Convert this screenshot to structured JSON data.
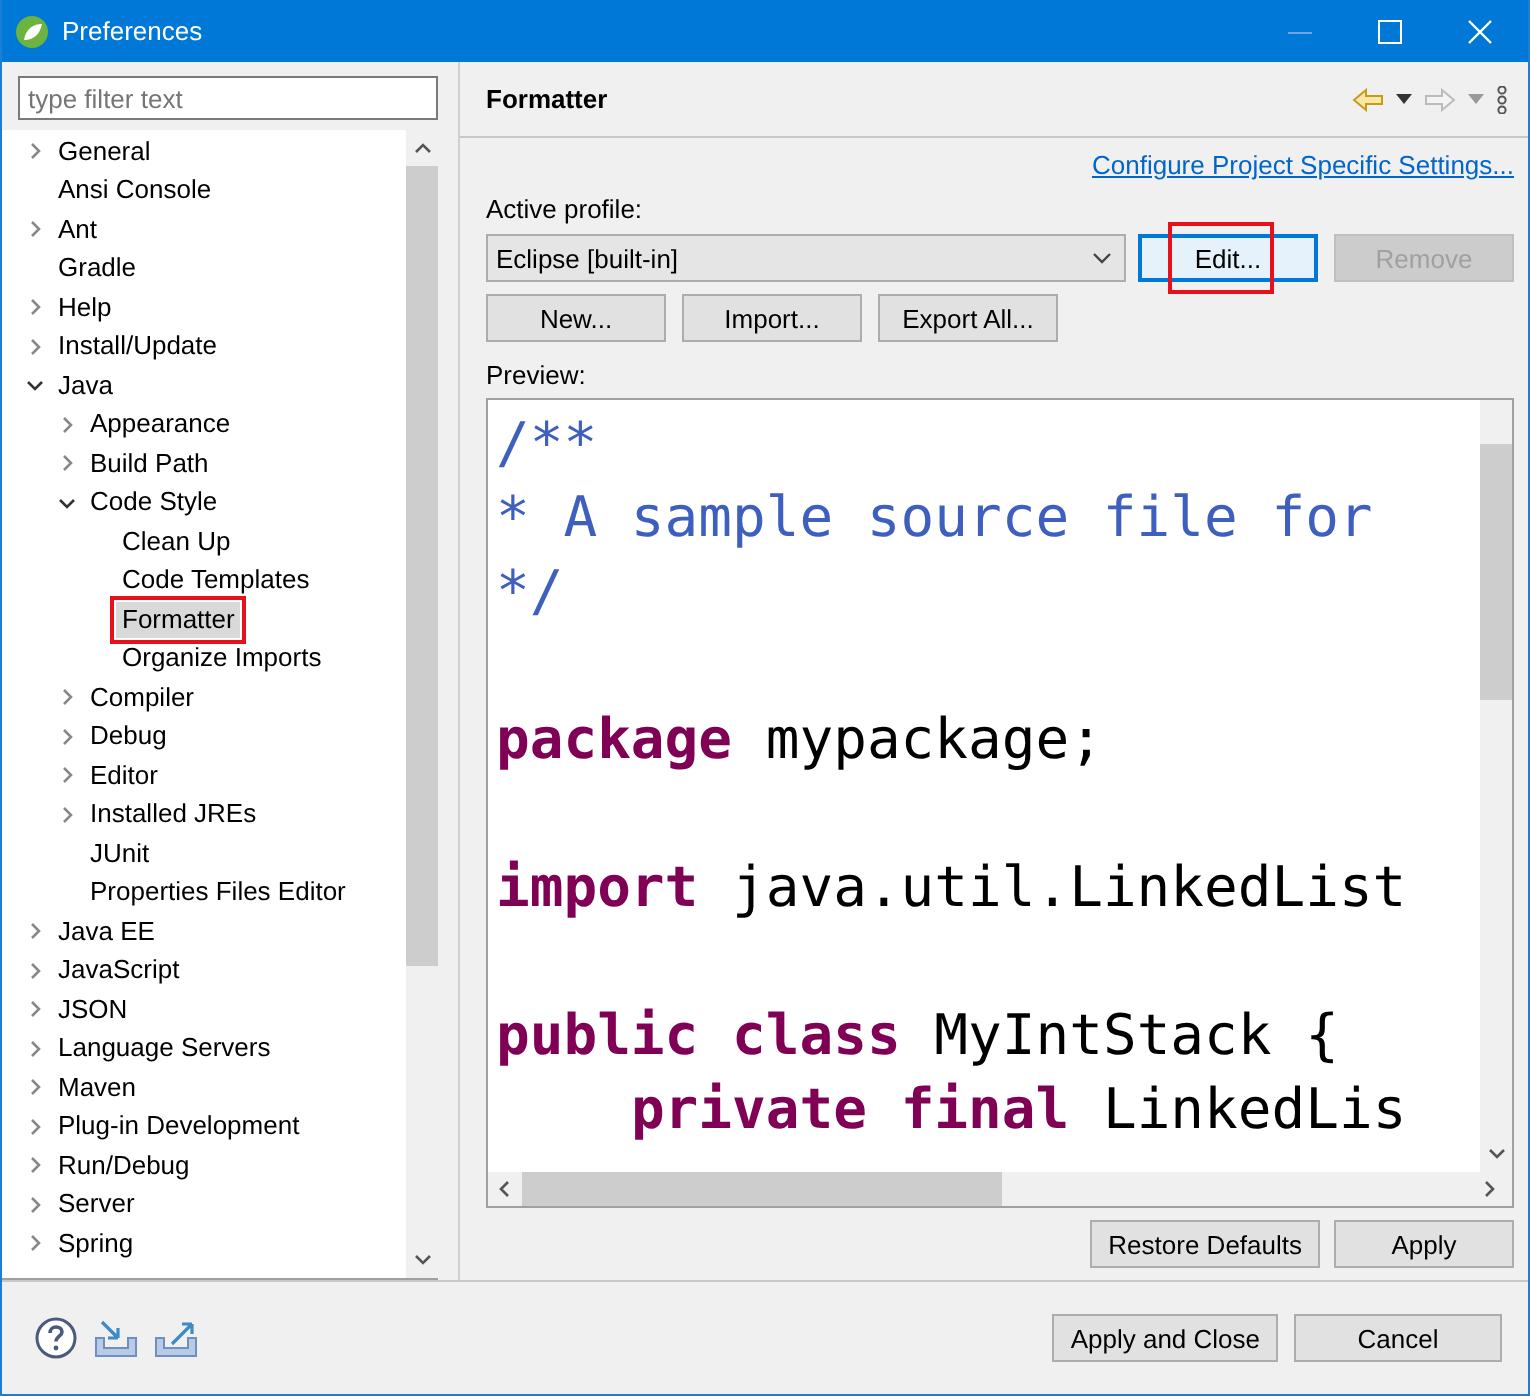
{
  "window": {
    "title": "Preferences"
  },
  "filter": {
    "placeholder": "type filter text"
  },
  "tree": [
    {
      "label": "General",
      "kind": "branch",
      "expanded": false,
      "selected": false,
      "highlighted": false
    },
    {
      "label": "Ansi Console",
      "kind": "leaf",
      "selected": false,
      "highlighted": false
    },
    {
      "label": "Ant",
      "kind": "branch",
      "expanded": false,
      "selected": false,
      "highlighted": false
    },
    {
      "label": "Gradle",
      "kind": "leaf",
      "selected": false,
      "highlighted": false
    },
    {
      "label": "Help",
      "kind": "branch",
      "expanded": false,
      "selected": false,
      "highlighted": false
    },
    {
      "label": "Install/Update",
      "kind": "branch",
      "expanded": false,
      "selected": false,
      "highlighted": false
    },
    {
      "label": "Java",
      "kind": "branch",
      "expanded": true,
      "selected": false,
      "highlighted": false,
      "children": [
        {
          "label": "Appearance",
          "kind": "branch",
          "expanded": false,
          "selected": false,
          "highlighted": false
        },
        {
          "label": "Build Path",
          "kind": "branch",
          "expanded": false,
          "selected": false,
          "highlighted": false
        },
        {
          "label": "Code Style",
          "kind": "branch",
          "expanded": true,
          "selected": false,
          "highlighted": false,
          "children": [
            {
              "label": "Clean Up",
              "kind": "leaf",
              "selected": false,
              "highlighted": false
            },
            {
              "label": "Code Templates",
              "kind": "leaf",
              "selected": false,
              "highlighted": false
            },
            {
              "label": "Formatter",
              "kind": "leaf",
              "selected": true,
              "highlighted": true
            },
            {
              "label": "Organize Imports",
              "kind": "leaf",
              "selected": false,
              "highlighted": false
            }
          ]
        },
        {
          "label": "Compiler",
          "kind": "branch",
          "expanded": false,
          "selected": false,
          "highlighted": false
        },
        {
          "label": "Debug",
          "kind": "branch",
          "expanded": false,
          "selected": false,
          "highlighted": false
        },
        {
          "label": "Editor",
          "kind": "branch",
          "expanded": false,
          "selected": false,
          "highlighted": false
        },
        {
          "label": "Installed JREs",
          "kind": "branch",
          "expanded": false,
          "selected": false,
          "highlighted": false
        },
        {
          "label": "JUnit",
          "kind": "leaf",
          "selected": false,
          "highlighted": false
        },
        {
          "label": "Properties Files Editor",
          "kind": "leaf",
          "selected": false,
          "highlighted": false
        }
      ]
    },
    {
      "label": "Java EE",
      "kind": "branch",
      "expanded": false,
      "selected": false,
      "highlighted": false
    },
    {
      "label": "JavaScript",
      "kind": "branch",
      "expanded": false,
      "selected": false,
      "highlighted": false
    },
    {
      "label": "JSON",
      "kind": "branch",
      "expanded": false,
      "selected": false,
      "highlighted": false
    },
    {
      "label": "Language Servers",
      "kind": "branch",
      "expanded": false,
      "selected": false,
      "highlighted": false
    },
    {
      "label": "Maven",
      "kind": "branch",
      "expanded": false,
      "selected": false,
      "highlighted": false
    },
    {
      "label": "Plug-in Development",
      "kind": "branch",
      "expanded": false,
      "selected": false,
      "highlighted": false
    },
    {
      "label": "Run/Debug",
      "kind": "branch",
      "expanded": false,
      "selected": false,
      "highlighted": false
    },
    {
      "label": "Server",
      "kind": "branch",
      "expanded": false,
      "selected": false,
      "highlighted": false
    },
    {
      "label": "Spring",
      "kind": "branch",
      "expanded": false,
      "selected": false,
      "highlighted": false
    }
  ],
  "page": {
    "title": "Formatter",
    "link": "Configure Project Specific Settings...",
    "profile_label": "Active profile:",
    "profile_value": "Eclipse [built-in]",
    "profile_buttons": [
      {
        "label": "Edit...",
        "disabled": false,
        "focused": true,
        "highlighted": true
      },
      {
        "label": "Remove",
        "disabled": true,
        "focused": false,
        "highlighted": false
      }
    ],
    "buttons": [
      {
        "label": "New...",
        "disabled": false
      },
      {
        "label": "Import...",
        "disabled": false
      },
      {
        "label": "Export All...",
        "disabled": false
      }
    ],
    "preview_label": "Preview:",
    "code": [
      {
        "text": "/**",
        "kind": "comment"
      },
      {
        "text": "* A sample source file for",
        "kind": "comment"
      },
      {
        "text": "*/",
        "kind": "comment"
      },
      {
        "kind": "blank"
      },
      {
        "text": "**package** mypackage;",
        "kind": "code"
      },
      {
        "kind": "blank"
      },
      {
        "text": "**import** java.util.LinkedList",
        "kind": "code"
      },
      {
        "kind": "blank"
      },
      {
        "text": "**public** **class** MyIntStack {",
        "kind": "code"
      },
      {
        "text": "    **private** **final** LinkedLis",
        "kind": "code"
      }
    ],
    "page_buttons": [
      "Restore Defaults",
      "Apply"
    ]
  },
  "footer_buttons": [
    "Apply and Close",
    "Cancel"
  ]
}
